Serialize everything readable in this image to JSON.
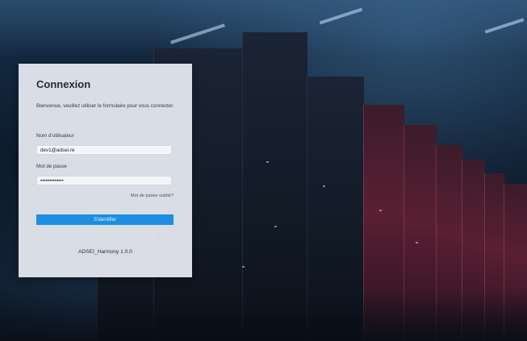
{
  "login": {
    "title": "Connexion",
    "welcome_text": "Bienvenue, veuillez utiliser le formulaire pour vous connecter.",
    "username_label": "Nom d'utilisateur",
    "username_value": "dev1@adsei.re",
    "password_label": "Mot de passe",
    "password_value": "•••••••••••••",
    "forgot_password_link": "Mot de passe oublié?",
    "submit_label": "S'identifier",
    "version_text": "ADSEI_Harmony 1.0.0"
  },
  "colors": {
    "primary_button": "#1e8fe0",
    "panel_background": "#e8ecf3",
    "background_dark": "#0e1a2a"
  }
}
